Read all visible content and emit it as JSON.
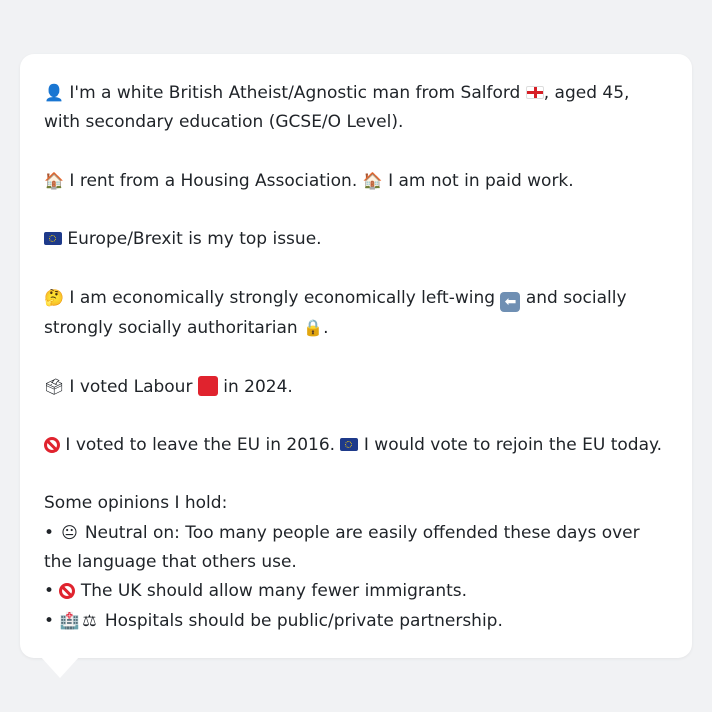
{
  "profile": {
    "line1_pre": "I'm a white British Atheist/Agnostic man from Salford",
    "line1_post": ", aged 45, with secondary education (GCSE/O Level).",
    "housing": "I rent from a Housing Association.",
    "work": "I am not in paid work.",
    "top_issue": "Europe/Brexit is my top issue.",
    "econ_pre": "I am economically strongly economically left-wing",
    "econ_post": "and socially strongly socially authoritarian",
    "econ_end": ".",
    "vote_pre": "I voted Labour",
    "vote_post": "in 2024.",
    "brexit_pre": "I voted to leave the EU in 2016.",
    "brexit_post": "I would vote to rejoin the EU today.",
    "opinions_header": "Some opinions I hold:",
    "opinions": [
      {
        "bullet": "•",
        "text": "Neutral on: Too many people are easily offended these days over the language that others use."
      },
      {
        "bullet": "•",
        "text": "The UK should allow many fewer immigrants."
      },
      {
        "bullet": "•",
        "text": "Hospitals should be public/private partnership."
      }
    ]
  },
  "icons": {
    "person": "👤",
    "house": "🏠",
    "thinking": "🤔",
    "lock": "🔒",
    "ballot": "🗳",
    "neutral": "😐",
    "hospital": "🏥",
    "scales": "⚖",
    "arrow": "⬅"
  },
  "colors": {
    "background": "#f1f2f4",
    "card": "#ffffff",
    "text": "#1f2328",
    "labour_red": "#e0232e",
    "eu_blue": "#1e3a8a"
  }
}
